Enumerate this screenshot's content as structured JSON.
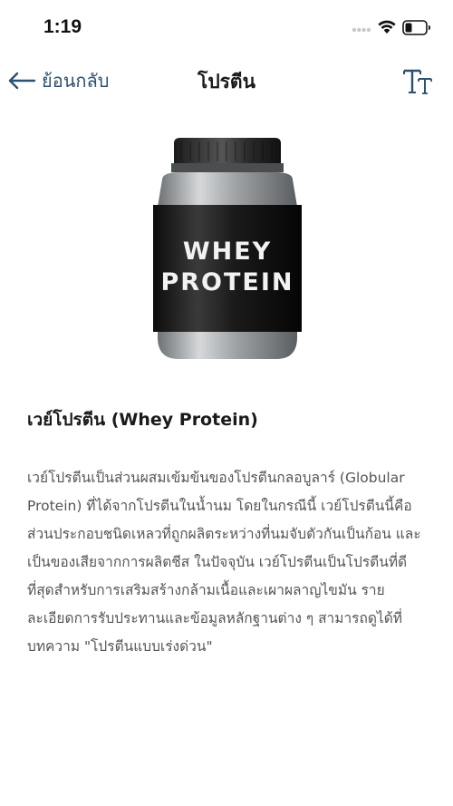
{
  "status_bar": {
    "time": "1:19"
  },
  "nav": {
    "back_label": "ย้อนกลับ",
    "title": "โปรตีน",
    "text_size_icon": "text-size-icon"
  },
  "product": {
    "label_line1": "WHEY",
    "label_line2": "PROTEIN"
  },
  "article": {
    "title": "เวย์โปรตีน (Whey Protein)",
    "body": "เวย์โปรตีนเป็นส่วนผสมเข้มข้นของโปรตีนกลอบูลาร์ (Globular Protein) ที่ได้จากโปรตีนในน้ำนม โดยในกรณีนี้ เวย์โปรตีนนี้คือ ส่วนประกอบชนิดเหลวที่ถูกผลิตระหว่างที่นมจับตัวกันเป็นก้อน และเป็นของเสียจากการผลิตชีส ในปัจจุบัน เวย์โปรตีนเป็นโปรตีนที่ดีที่สุดสำหรับการเสริมสร้างกล้ามเนื้อและเผาผลาญไขมัน รายละเอียดการรับประทานและข้อมูลหลักฐานต่าง ๆ สามารถดูได้ที่บทความ \"โปรตีนแบบเร่งด่วน\""
  },
  "colors": {
    "accent": "#2d5170",
    "title_text": "#1a1a1a",
    "body_text": "#555555"
  }
}
